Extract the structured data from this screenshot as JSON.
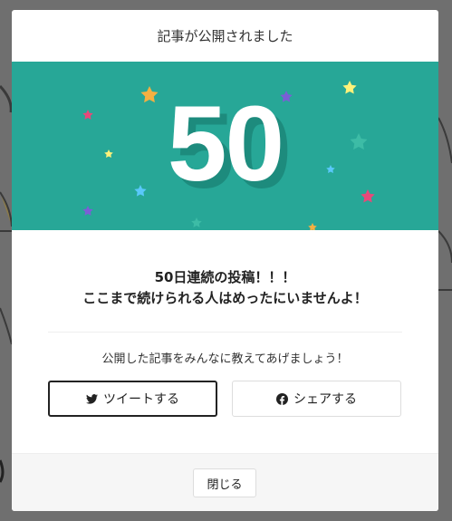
{
  "modal": {
    "title": "記事が公開されました",
    "count": "50",
    "message_line1": "50日連続の投稿！！！",
    "message_line2": "ここまで続けられる人はめったにいませんよ！",
    "share_prompt": "公開した記事をみんなに教えてあげましょう！",
    "tweet_button": "ツイートする",
    "share_button": "シェアする",
    "close_button": "閉じる"
  },
  "colors": {
    "banner": "#27a797",
    "overlay": "#6f6f6f"
  },
  "icons": {
    "tweet": "twitter-icon",
    "share": "facebook-icon",
    "decorations": "star-icon"
  }
}
